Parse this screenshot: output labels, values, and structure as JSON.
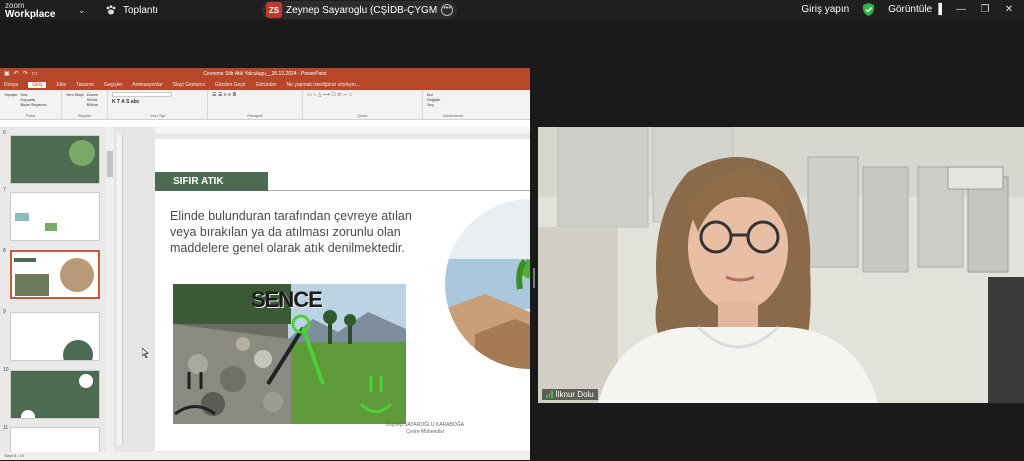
{
  "app": {
    "brand_line1": "zoom",
    "brand_line2": "Workplace"
  },
  "meeting": {
    "label": "Toplantı"
  },
  "sharer": {
    "initials": "ZS",
    "name": "Zeynep Sayaroglu (CŞİDB-ÇYGM"
  },
  "top_right": {
    "signin": "Giriş yapın",
    "view": "Görüntüle"
  },
  "powerpoint": {
    "title": "Cevreme Sifir Atik Yolculugu__26.12.2024 - PowerPoint",
    "tabs": [
      "Dosya",
      "Giriş",
      "Ekle",
      "Tasarım",
      "Geçişler",
      "Animasyonlar",
      "Slayt Gösterisi",
      "Gözden Geçir",
      "Görünüm",
      "Ne yapmak istediğinizi söyleyin..."
    ],
    "ribbon_groups": [
      "Pano",
      "Slaytlar",
      "Yazı Tipi",
      "Paragraf",
      "Çizim",
      "Düzenleme"
    ],
    "ribbon_buttons": {
      "paste": "Yapıştır",
      "cut": "Kes",
      "copy": "Kopyala",
      "format": "Biçim Boyacısı",
      "new_slide": "Yeni Slayt",
      "layout": "Düzen",
      "reset": "Sıfırla",
      "section": "Bölüm",
      "find": "Bul",
      "replace": "Değiştir",
      "select": "Seç"
    },
    "status_bar": "Slayt 8 / 19",
    "thumb_numbers": [
      "6",
      "7",
      "8",
      "9",
      "10",
      "11"
    ]
  },
  "slide": {
    "heading": "SIFIR ATIK",
    "body": "Elinde bulunduran tarafından çevreye atılan veya bırakılan ya da atılması zorunlu olan maddelere genel olarak atık denilmektedir.",
    "image_word": "SENCE",
    "credit_line1": "Zeynep SAYAROĞLU KARABOĞA",
    "credit_line2": "Çevre Mühendisi"
  },
  "participant": {
    "name": "İlknur Dolu"
  },
  "colors": {
    "ppt_accent": "#b7472a",
    "slide_banner": "#4d6b52",
    "thumb_selected": "#c45a37",
    "signal": "#33cc33"
  }
}
